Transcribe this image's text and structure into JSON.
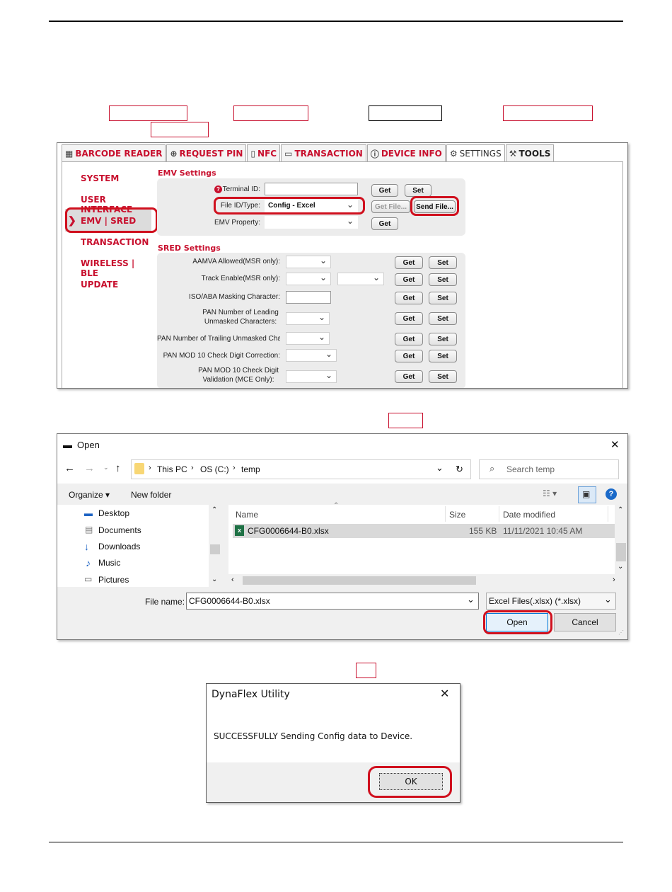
{
  "utility": {
    "tabs": [
      {
        "label": "BARCODE READER",
        "icon": "barcode-icon",
        "glyph": "▦"
      },
      {
        "label": "REQUEST PIN",
        "icon": "globe-icon",
        "glyph": "⊕"
      },
      {
        "label": "NFC",
        "icon": "nfc-icon",
        "glyph": "▯"
      },
      {
        "label": "TRANSACTION",
        "icon": "card-icon",
        "glyph": "▭"
      },
      {
        "label": "DEVICE INFO",
        "icon": "info-icon",
        "glyph": "ⓘ"
      },
      {
        "label": "SETTINGS",
        "icon": "gear-icon",
        "glyph": "⚙"
      },
      {
        "label": "TOOLS",
        "icon": "tools-icon",
        "glyph": "⚒"
      }
    ],
    "sidebar": [
      "SYSTEM",
      "USER INTERFACE",
      "EMV | SRED",
      "TRANSACTION",
      "WIRELESS | BLE",
      "UPDATE"
    ],
    "emv": {
      "title": "EMV Settings",
      "terminal_label": "Terminal ID:",
      "file_label": "File ID/Type:",
      "file_value": "Config - Excel",
      "property_label": "EMV Property:",
      "get": "Get",
      "set": "Set",
      "get_file": "Get File...",
      "send_file": "Send File..."
    },
    "sred": {
      "title": "SRED Settings",
      "rows": [
        "AAMVA Allowed(MSR only):",
        "Track Enable(MSR only):",
        "ISO/ABA Masking Character:",
        "PAN Number of Leading Unmasked Characters:",
        "PAN Number of Trailing Unmasked Cha",
        "PAN MOD 10 Check Digit Correction:",
        "PAN MOD 10 Check Digit Validation (MCE Only):"
      ],
      "get": "Get",
      "set": "Set"
    }
  },
  "open_dialog": {
    "title": "Open",
    "close": "✕",
    "breadcrumb": [
      "This PC",
      "OS (C:)",
      "temp"
    ],
    "search_placeholder": "Search temp",
    "organize": "Organize ▾",
    "new_folder": "New folder",
    "nav_items": [
      "Desktop",
      "Documents",
      "Downloads",
      "Music",
      "Pictures"
    ],
    "columns": [
      "Name",
      "Size",
      "Date modified"
    ],
    "file": {
      "name": "CFG0006644-B0.xlsx",
      "size": "155 KB",
      "date": "11/11/2021 10:45 AM"
    },
    "file_name_label": "File name:",
    "file_name_value": "CFG0006644-B0.xlsx",
    "file_type": "Excel Files(.xlsx) (*.xlsx)",
    "open_button": "Open",
    "cancel_button": "Cancel"
  },
  "message_box": {
    "title": "DynaFlex Utility",
    "close": "✕",
    "message": "SUCCESSFULLY Sending Config data to Device.",
    "ok": "OK"
  }
}
